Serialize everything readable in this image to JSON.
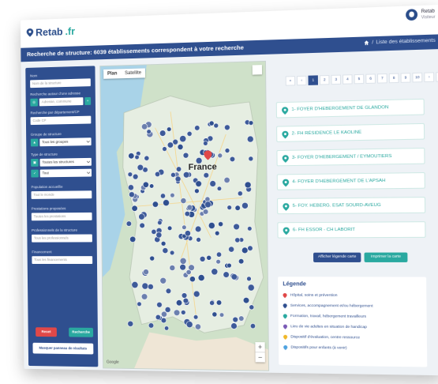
{
  "app": {
    "logo_text": "Retab",
    "logo_suffix": ".fr"
  },
  "user": {
    "name": "Retab",
    "role": "Visiteur"
  },
  "titlebar": {
    "title": "Recherche de structure: 6039 établissements correspondent à votre recherche",
    "breadcrumb": "Liste des établissements"
  },
  "sidebar": {
    "nom_label": "Nom",
    "nom_placeholder": "Nom de la structure",
    "adresse_label": "Recherche autour d'une adresse",
    "adresse_placeholder": "Adresse, commune",
    "departement_label": "Recherche par département/CP",
    "departement_placeholder": "Code CP",
    "groupe_label": "Groupe de structure",
    "groupe_value": "Tous les groupes",
    "type_label": "Type de structure",
    "type_value": "Toutes les structures",
    "etat_value": "Tout",
    "population_label": "Population accueillie",
    "population_placeholder": "Tout le monde",
    "prestations_label": "Prestations proposées",
    "prestations_placeholder": "Toutes les prestations",
    "professionnels_label": "Professionnels de la structure",
    "professionnels_placeholder": "Tous les professionnels",
    "financement_label": "Financement",
    "financement_placeholder": "Tous les financements",
    "reset_label": "Reset",
    "search_label": "Recherche",
    "hide_label": "Masquer panneau de résultats"
  },
  "map": {
    "tab_plan": "Plan",
    "tab_satellite": "Satellite",
    "country_label": "France",
    "attribution": "Google",
    "zoom_in": "+",
    "zoom_out": "−"
  },
  "pager": {
    "first": "«",
    "prev": "‹",
    "pages": [
      "1",
      "2",
      "3",
      "4",
      "5",
      "6",
      "7",
      "8",
      "9",
      "10"
    ],
    "active_page": "1",
    "next": "›",
    "last": "»"
  },
  "results": [
    "1- FOYER D'HEBERGEMENT DE GLANDON",
    "2- FH RÉSIDENCE LE KAOLINE",
    "3- FOYER D'HEBERGEMENT / EYMOUTIERS",
    "4- FOYER D'HEBERGEMENT DE L'APSAH",
    "5- FOY. HEBERG. ESAT SOURD-AVEUG",
    "6- FH ESSOR - CH LABORIT"
  ],
  "actions": {
    "legend_button": "Afficher légende carte",
    "print_button": "Imprimer la carte"
  },
  "legend": {
    "title": "Légende",
    "items": [
      {
        "label": "Hôpital, soins et prévention",
        "color": "#e04848"
      },
      {
        "label": "Services, accompagnement et/ou hébergement",
        "color": "#2f4f8f"
      },
      {
        "label": "Formation, travail, hébergement travailleurs",
        "color": "#2aa9a0"
      },
      {
        "label": "Lieu de vie adultes en situation de handicap",
        "color": "#7b5bb6"
      },
      {
        "label": "Dispositif d'évaluation, centre ressource",
        "color": "#f0b82a"
      },
      {
        "label": "Dispositifs pour enfants (à venir)",
        "color": "#4fa3e0"
      }
    ]
  },
  "colors": {
    "primary": "#2f4f8f",
    "accent": "#2aa9a0",
    "danger": "#e04848"
  }
}
